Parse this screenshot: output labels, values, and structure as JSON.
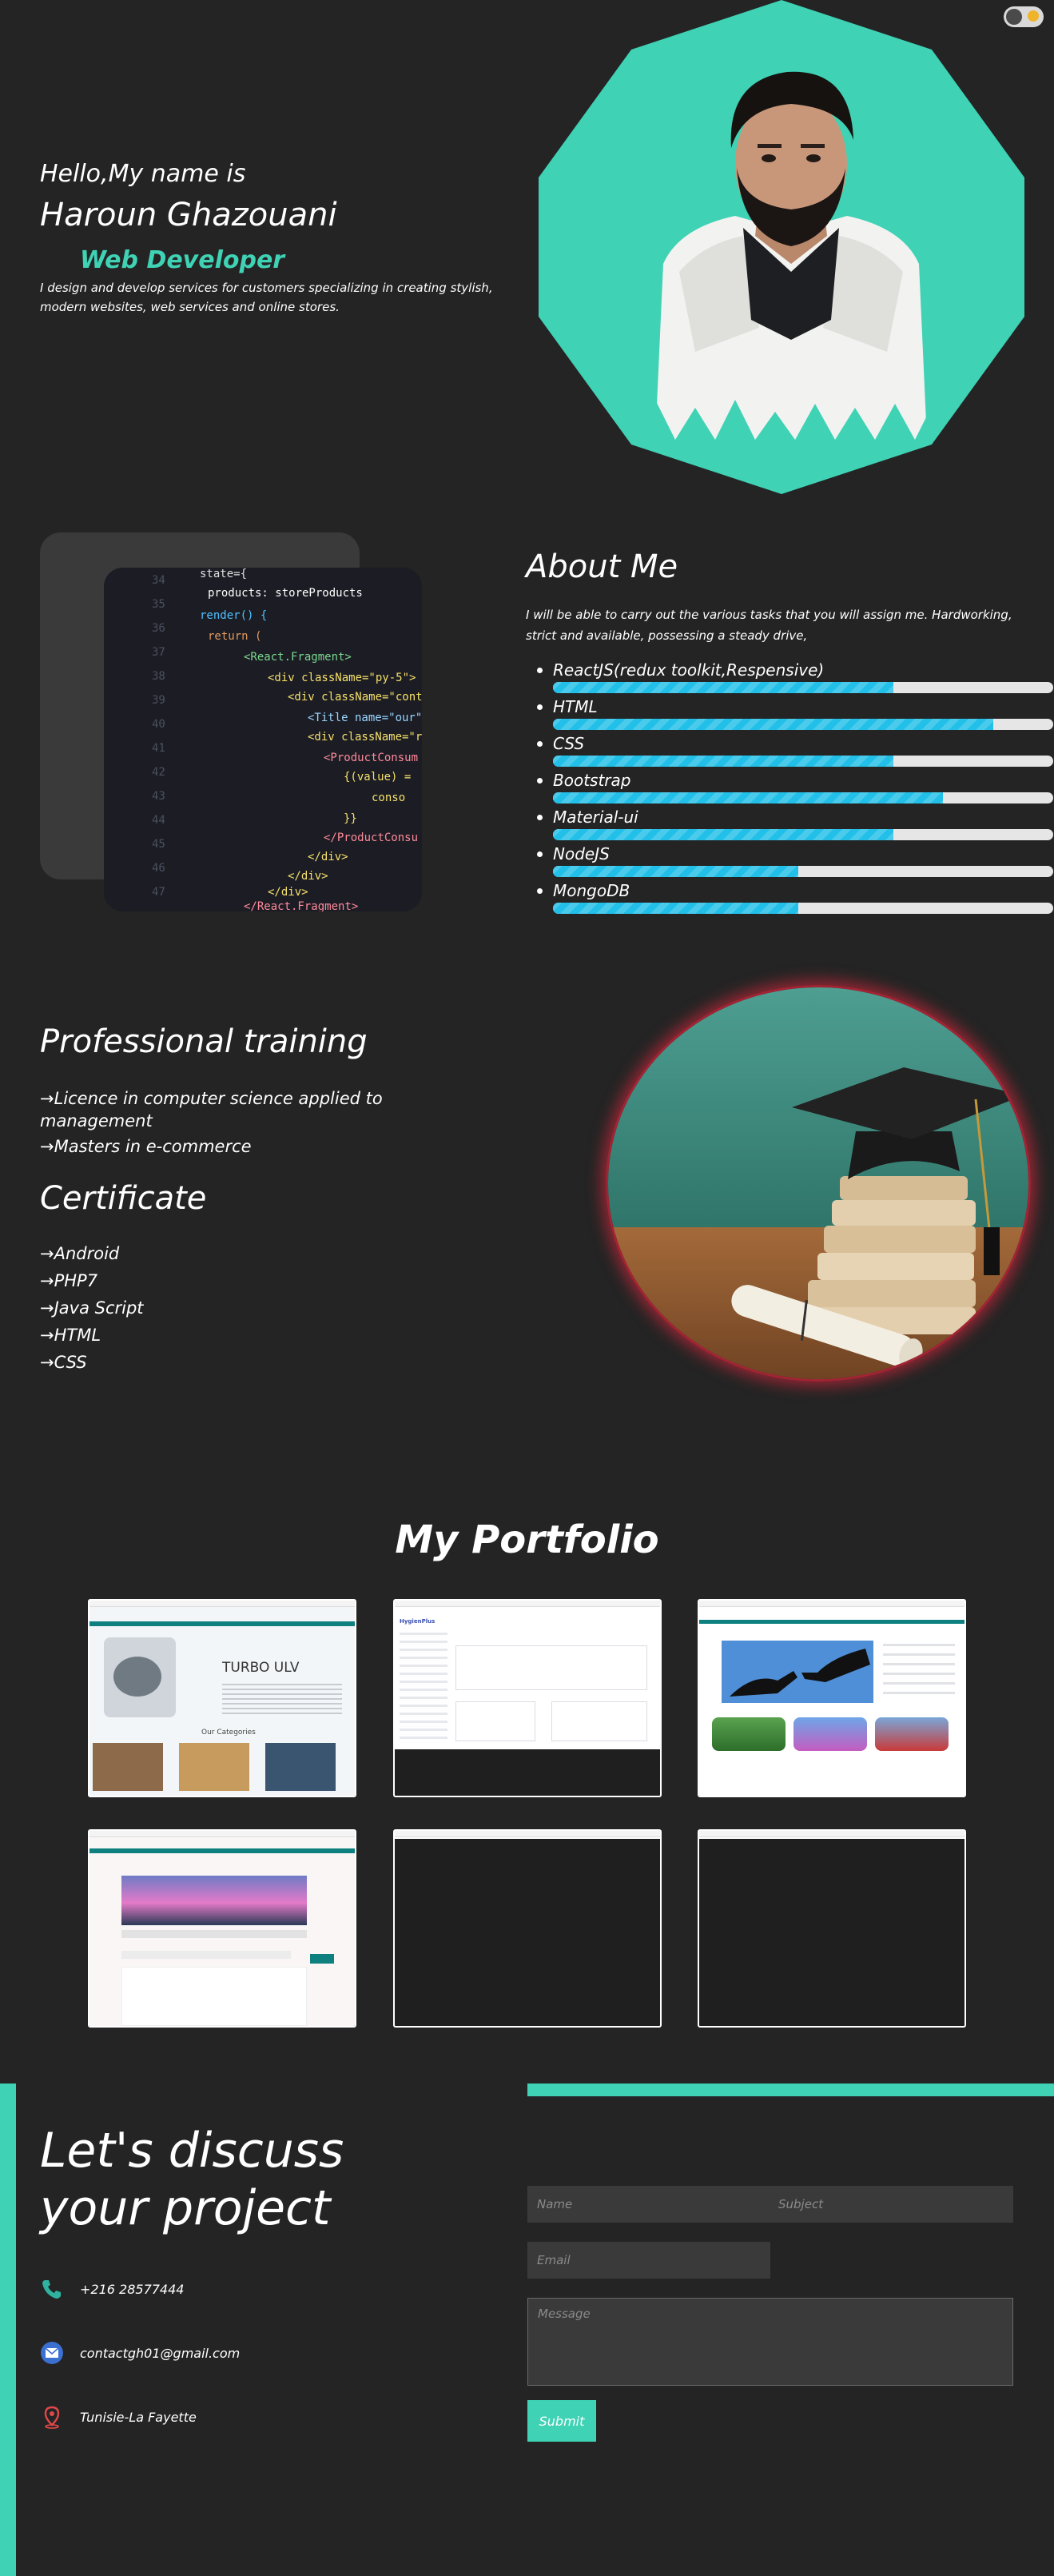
{
  "colors": {
    "accent": "#3fd2b4",
    "background": "#242424",
    "progress": "#22c0e8",
    "track": "#e6e6e6"
  },
  "hero": {
    "greeting": "Hello,My name is",
    "name": "Haroun Ghazouani",
    "role": "Web Developer",
    "intro": "I design and develop services for customers specializing in creating stylish, modern websites, web services and online stores."
  },
  "about": {
    "title": "About Me",
    "text": "I will be able to carry out the various tasks that you will assign me. Hardworking, strict and available, possessing a steady drive,",
    "skills": [
      {
        "label": "ReactJS(redux toolkit,Respensive)",
        "level": 0.68
      },
      {
        "label": "HTML",
        "level": 0.88
      },
      {
        "label": "CSS",
        "level": 0.68
      },
      {
        "label": "Bootstrap",
        "level": 0.78
      },
      {
        "label": "Material-ui",
        "level": 0.68
      },
      {
        "label": "NodeJS",
        "level": 0.49
      },
      {
        "label": "MongoDB",
        "level": 0.49
      }
    ]
  },
  "training": {
    "title": "Professional training",
    "items": [
      "→Licence in computer science applied to management",
      "→Masters in e-commerce"
    ]
  },
  "certificate": {
    "title": "Certificate",
    "items": [
      "→Android",
      "→PHP7",
      "→Java Script",
      "→HTML",
      "→CSS"
    ]
  },
  "portfolio": {
    "title": "My Portfolio",
    "shot1": {
      "heading": "TURBO ULV",
      "subheading": "Our Categories"
    },
    "shot2": {
      "brand": "HygienPlus"
    }
  },
  "contact": {
    "title": "Let's discuss your project",
    "phone": "+216 28577444",
    "email": "contactgh01@gmail.com",
    "address": "Tunisie-La Fayette",
    "form": {
      "name_placeholder": "Name",
      "subject_placeholder": "Subject",
      "email_placeholder": "Email",
      "message_placeholder": "Message",
      "submit_label": "Submit"
    }
  }
}
